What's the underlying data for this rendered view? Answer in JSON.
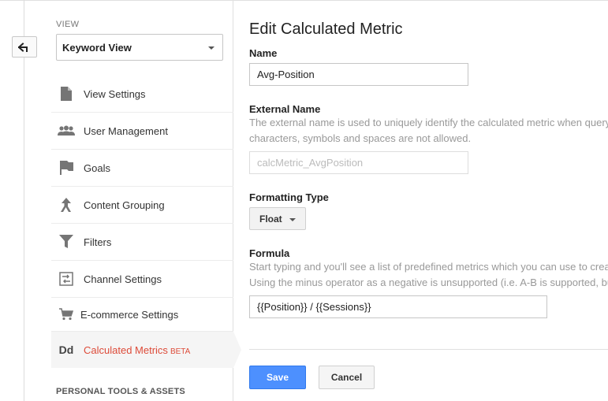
{
  "nav": {
    "view_label": "VIEW",
    "view_select_value": "Keyword View",
    "items": [
      {
        "label": "View Settings",
        "icon": "document-icon"
      },
      {
        "label": "User Management",
        "icon": "users-icon"
      },
      {
        "label": "Goals",
        "icon": "flag-icon"
      },
      {
        "label": "Content Grouping",
        "icon": "content-grouping-icon"
      },
      {
        "label": "Filters",
        "icon": "filter-icon"
      },
      {
        "label": "Channel Settings",
        "icon": "channel-settings-icon"
      },
      {
        "label": "E-commerce Settings",
        "icon": "cart-icon"
      },
      {
        "label": "Calculated Metrics",
        "badge": "BETA",
        "icon": "dd-icon",
        "icon_text": "Dd",
        "active": true
      }
    ],
    "section_personal": "PERSONAL TOOLS & ASSETS"
  },
  "form": {
    "title": "Edit Calculated Metric",
    "name_label": "Name",
    "name_value": "Avg-Position",
    "external_label": "External Name",
    "external_help_1": "The external name is used to uniquely identify the calculated metric when query",
    "external_help_2": "characters, symbols and spaces are not allowed.",
    "external_value": "calcMetric_AvgPosition",
    "formatting_label": "Formatting Type",
    "formatting_value": "Float",
    "formula_label": "Formula",
    "formula_help_1": "Start typing and you'll see a list of predefined metrics which you can use to crea",
    "formula_help_2": "Using the minus operator as a negative is unsupported (i.e. A-B is supported, bu",
    "formula_value": "{{Position}} / {{Sessions}}",
    "save_label": "Save",
    "cancel_label": "Cancel"
  },
  "colors": {
    "accent_red": "#dd4b39",
    "save_blue": "#4d90fe"
  }
}
